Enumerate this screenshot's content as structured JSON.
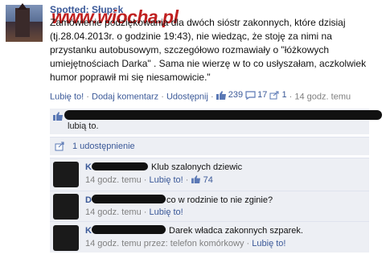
{
  "post": {
    "page_name": "Spotted: Słupsk",
    "watermark": "www.wiocha.pl",
    "text": "Zamówienie podziękowania dla dwóch sióstr zakonnych, które dzisiaj (tj.28.04.2013r. o godzinie 19:43), nie wiedząc, że stoję za nimi na przystanku autobusowym, szczegółowo rozmawiały o \"łóżkowych umiejętnościach Darka\" . Sama nie wierzę w to co usłyszałam, aczkolwiek humor poprawił mi się niesamowicie.\""
  },
  "actions": {
    "like": "Lubię to!",
    "comment": "Dodaj komentarz",
    "share": "Udostępnij",
    "likes_count": "239",
    "comments_count": "17",
    "shares_count": "1",
    "time": "14 godz. temu"
  },
  "likes_box": {
    "text": "lubią to."
  },
  "shares_box": {
    "text": "1 udostępnienie"
  },
  "comments": [
    {
      "name": "K",
      "text": "Klub szalonych dziewic",
      "time": "14 godz. temu",
      "like": "Lubię to!",
      "likes": "74"
    },
    {
      "name": "D",
      "text": "co w rodzinie to nie zginie?",
      "time": "14 godz. temu",
      "like": "Lubię to!"
    },
    {
      "name": "K",
      "text": "Darek władca zakonnych szparek.",
      "time": "14 godz. temu przez: telefon komórkowy",
      "like": "Lubię to!"
    }
  ],
  "colors": {
    "link": "#3b5998",
    "meta": "#808080",
    "box_bg": "#edeff4",
    "watermark": "#c02020"
  }
}
